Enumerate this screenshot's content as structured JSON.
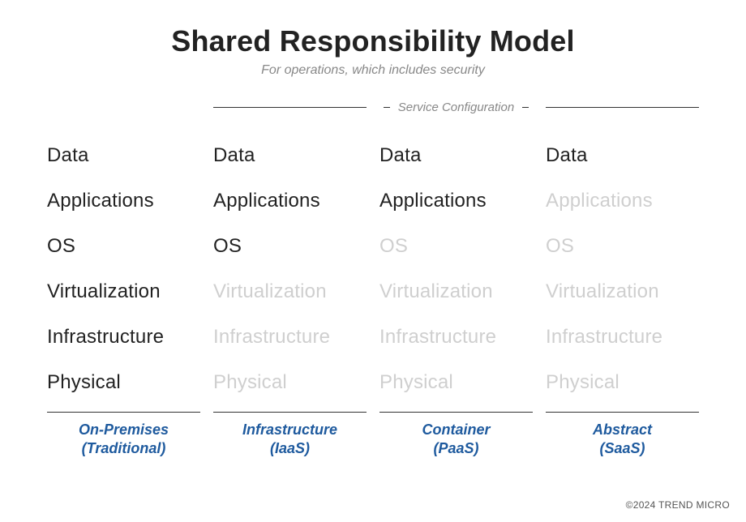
{
  "title": "Shared Responsibility Model",
  "subtitle": "For operations, which includes security",
  "span_header": "Service Configuration",
  "layers": [
    "Data",
    "Applications",
    "OS",
    "Virtualization",
    "Infrastructure",
    "Physical"
  ],
  "columns": [
    {
      "id": "onprem",
      "label_line1": "On-Premises",
      "label_line2": "(Traditional)",
      "owned": [
        true,
        true,
        true,
        true,
        true,
        true
      ]
    },
    {
      "id": "iaas",
      "label_line1": "Infrastructure",
      "label_line2": "(IaaS)",
      "owned": [
        true,
        true,
        true,
        false,
        false,
        false
      ]
    },
    {
      "id": "paas",
      "label_line1": "Container",
      "label_line2": "(PaaS)",
      "owned": [
        true,
        true,
        false,
        false,
        false,
        false
      ]
    },
    {
      "id": "saas",
      "label_line1": "Abstract",
      "label_line2": "(SaaS)",
      "owned": [
        true,
        false,
        false,
        false,
        false,
        false
      ]
    }
  ],
  "copyright": "©2024 TREND MICRO",
  "colors": {
    "owned": "#222222",
    "notowned": "#cfcfcf",
    "label": "#1e5a9e"
  }
}
